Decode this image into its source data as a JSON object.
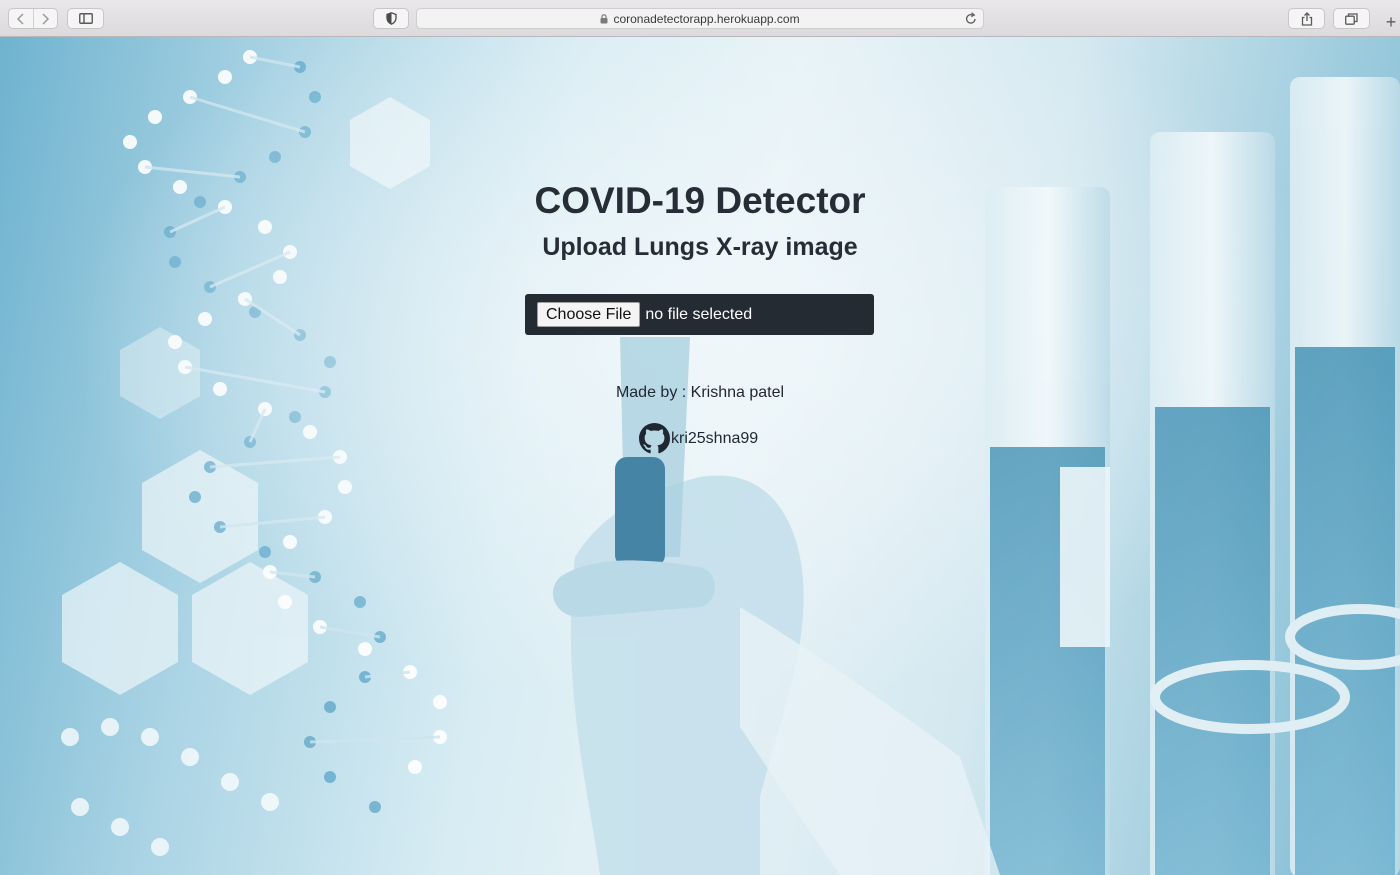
{
  "browser": {
    "url": "coronadetectorapp.herokuapp.com",
    "icons": {
      "back": "chevron-left-icon",
      "forward": "chevron-right-icon",
      "sidebar": "sidebar-icon",
      "privacy": "shield-icon",
      "lock": "lock-icon",
      "reload": "reload-icon",
      "share": "share-icon",
      "tabs": "tabs-icon",
      "new_tab": "plus-icon"
    }
  },
  "page": {
    "title": "COVID-19 Detector",
    "subtitle": "Upload Lungs X-ray image",
    "file_input": {
      "button_label": "Choose File",
      "status": "no file selected"
    },
    "author": "Made by : Krishna patel",
    "github_handle": "kri25shna99",
    "colors": {
      "heading": "#262d36",
      "file_box_bg": "#242b32",
      "background_tint": "#a9d3e4"
    }
  }
}
